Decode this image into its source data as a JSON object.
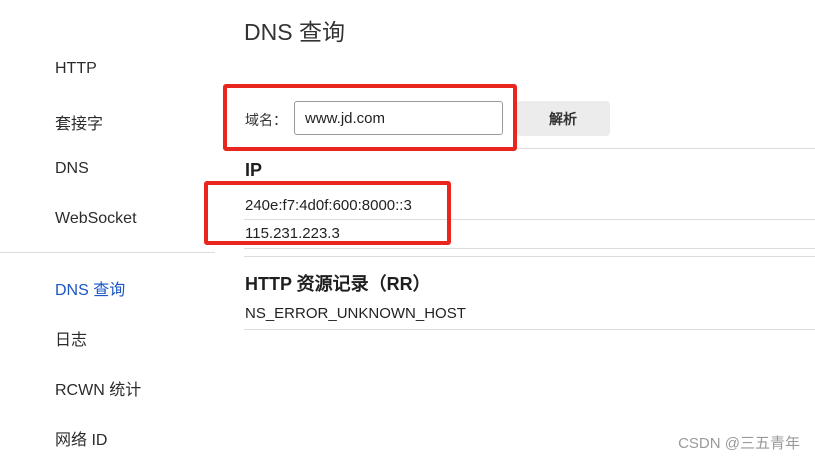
{
  "sidebar": {
    "items": [
      {
        "label": "HTTP",
        "active": false
      },
      {
        "label": "套接字",
        "active": false
      },
      {
        "label": "DNS",
        "active": false
      },
      {
        "label": "WebSocket",
        "active": false
      },
      {
        "label": "DNS 查询",
        "active": true
      },
      {
        "label": "日志",
        "active": false
      },
      {
        "label": "RCWN 统计",
        "active": false
      },
      {
        "label": "网络 ID",
        "active": false
      }
    ]
  },
  "main": {
    "title": "DNS 查询",
    "lookup": {
      "label": "域名：",
      "input_value": "www.jd.com",
      "button_label": "解析"
    },
    "ip_section": {
      "heading": "IP",
      "addresses": [
        "240e:f7:4d0f:600:8000::3",
        "115.231.223.3"
      ]
    },
    "rr_section": {
      "heading": "HTTP 资源记录（RR）",
      "value": "NS_ERROR_UNKNOWN_HOST"
    }
  },
  "watermark": "CSDN @三五青年",
  "colors": {
    "accent": "#1a56c4",
    "annotation": "#e8261d"
  }
}
